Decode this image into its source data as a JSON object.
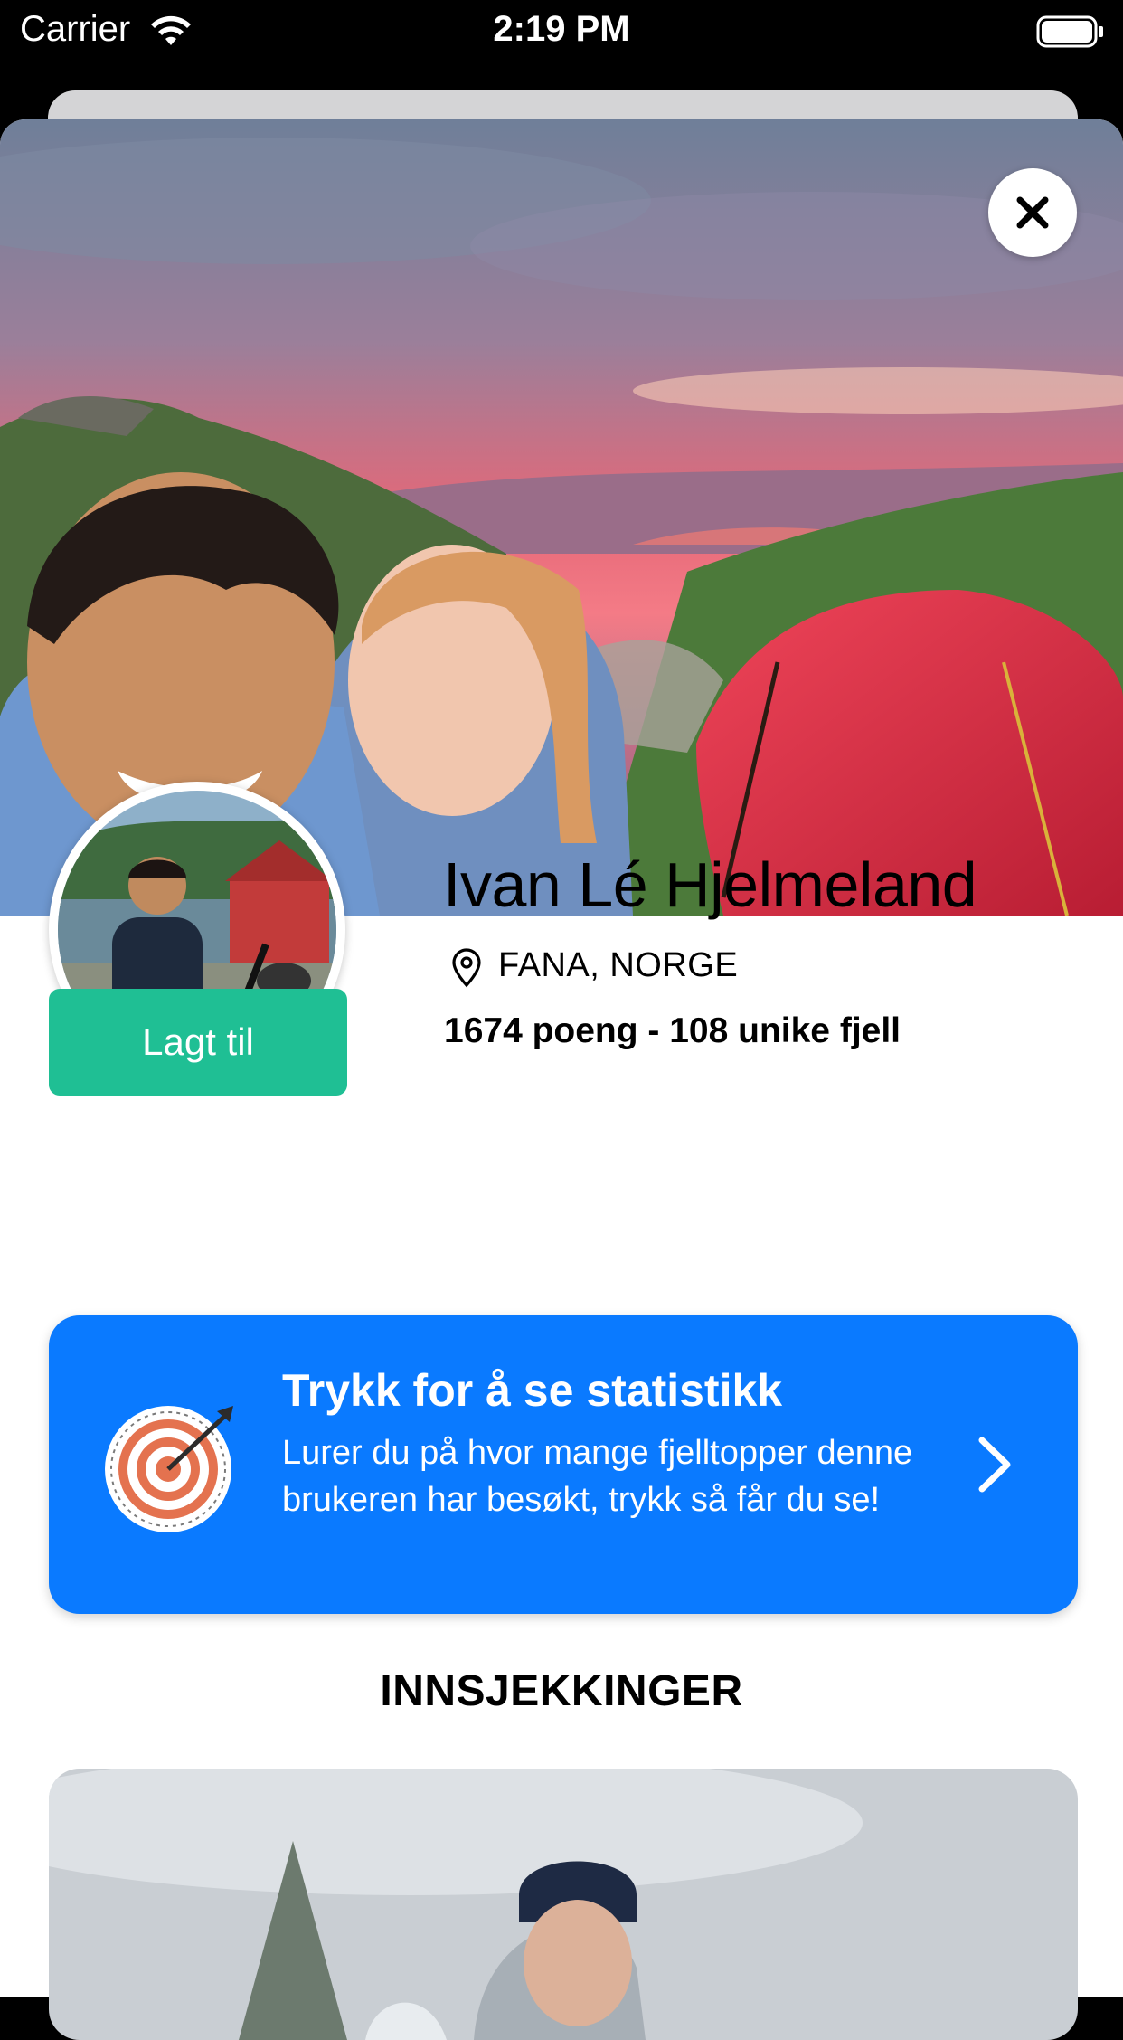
{
  "status_bar": {
    "carrier": "Carrier",
    "time": "2:19 PM"
  },
  "profile": {
    "name": "Ivan Lé Hjelmeland",
    "location": "FANA, NORGE",
    "stats": "1674 poeng - 108 unike fjell",
    "added_button_label": "Lagt til"
  },
  "stats_card": {
    "title": "Trykk for å se statistikk",
    "description": "Lurer du på hvor mange fjelltopper denne brukeren har besøkt, trykk så får du se!"
  },
  "checkins": {
    "section_title": "INNSJEKKINGER"
  },
  "colors": {
    "accent_green": "#1fbf94",
    "accent_blue": "#0a7aff"
  },
  "icons": [
    "wifi-icon",
    "battery-icon",
    "close-icon",
    "location-pin-icon",
    "target-icon",
    "chevron-right-icon"
  ]
}
